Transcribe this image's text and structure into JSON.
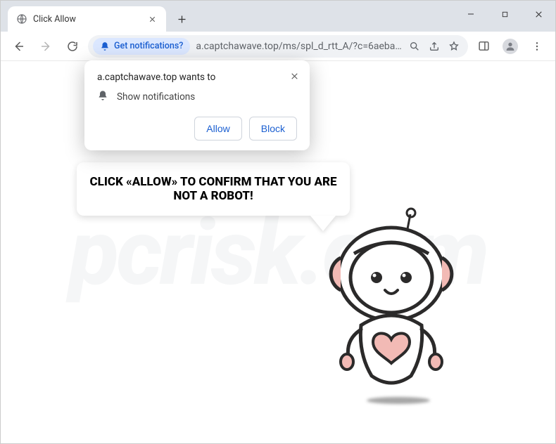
{
  "window": {
    "tab_title": "Click Allow"
  },
  "toolbar": {
    "notif_chip_label": "Get notifications?",
    "url": "a.captchawave.top/ms/spl_d_rtt_A/?c=6aeba4…"
  },
  "permission": {
    "origin_line": "a.captchawave.top wants to",
    "capability": "Show notifications",
    "allow": "Allow",
    "block": "Block"
  },
  "page": {
    "speech_text": "CLICK «ALLOW» TO CONFIRM THAT YOU ARE NOT A ROBOT!"
  },
  "watermark": "pcrisk.com",
  "colors": {
    "accent": "#1b5fd1",
    "robot_dark": "#2b2a2a",
    "robot_pink": "#f2bab5"
  }
}
